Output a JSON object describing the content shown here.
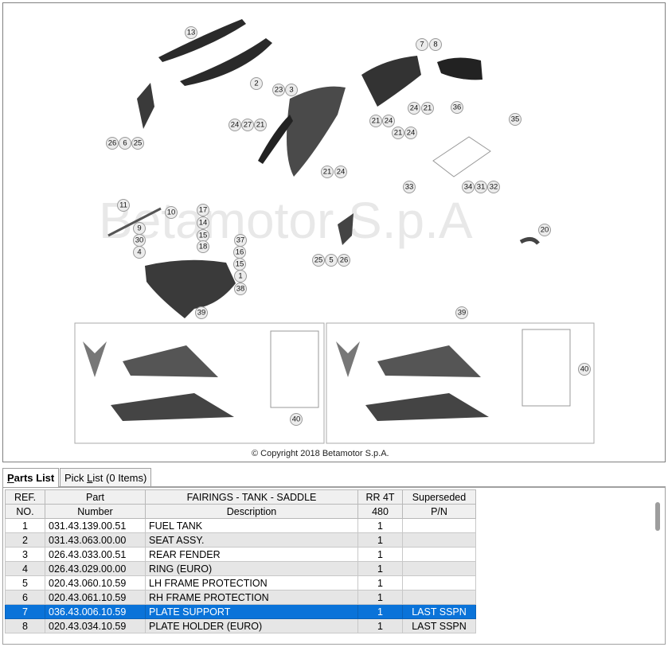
{
  "diagram": {
    "watermark": "Betamotor S.p.A",
    "copyright": "© Copyright 2018 Betamotor S.p.A.",
    "callouts": [
      "13",
      "2",
      "7",
      "8",
      "23",
      "3",
      "24",
      "27",
      "21",
      "24",
      "21",
      "36",
      "21",
      "24",
      "21",
      "24",
      "26",
      "6",
      "25",
      "35",
      "21",
      "24",
      "11",
      "10",
      "17",
      "14",
      "9",
      "15",
      "30",
      "18",
      "37",
      "4",
      "16",
      "15",
      "1",
      "38",
      "25",
      "5",
      "26",
      "20",
      "33",
      "34",
      "31",
      "32",
      "39",
      "39",
      "40",
      "40"
    ]
  },
  "tabs": {
    "parts_list": "Parts List",
    "pick_list": "Pick List (0 Items)"
  },
  "table": {
    "headers_row1": [
      "REF.",
      "Part",
      "FAIRINGS - TANK - SADDLE",
      "RR 4T",
      "Superseded"
    ],
    "headers_row2": [
      "NO.",
      "Number",
      "Description",
      "480",
      "P/N"
    ],
    "rows": [
      {
        "ref": "1",
        "part": "031.43.139.00.51",
        "desc": "FUEL TANK",
        "qty": "1",
        "sup": ""
      },
      {
        "ref": "2",
        "part": "031.43.063.00.00",
        "desc": "SEAT ASSY.",
        "qty": "1",
        "sup": ""
      },
      {
        "ref": "3",
        "part": "026.43.033.00.51",
        "desc": "REAR FENDER",
        "qty": "1",
        "sup": ""
      },
      {
        "ref": "4",
        "part": "026.43.029.00.00",
        "desc": "RING (EURO)",
        "qty": "1",
        "sup": ""
      },
      {
        "ref": "5",
        "part": "020.43.060.10.59",
        "desc": "LH FRAME PROTECTION",
        "qty": "1",
        "sup": ""
      },
      {
        "ref": "6",
        "part": "020.43.061.10.59",
        "desc": "RH FRAME PROTECTION",
        "qty": "1",
        "sup": ""
      },
      {
        "ref": "7",
        "part": "036.43.006.10.59",
        "desc": "PLATE SUPPORT",
        "qty": "1",
        "sup": "LAST SSPN"
      },
      {
        "ref": "8",
        "part": "020.43.034.10.59",
        "desc": "PLATE HOLDER (EURO)",
        "qty": "1",
        "sup": "LAST SSPN"
      }
    ],
    "selected_ref": "7"
  }
}
